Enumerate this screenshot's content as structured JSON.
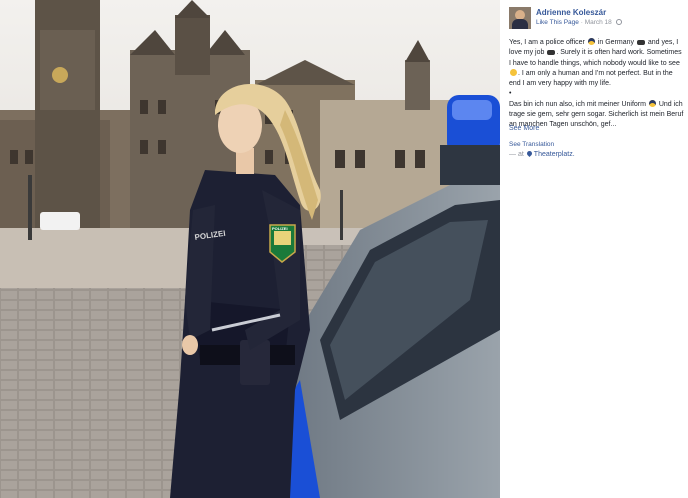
{
  "post": {
    "author": "Adrienne Koleszár",
    "like_page": "Like This Page",
    "separator": "·",
    "date": "March 18",
    "paragraph1_a": "Yes, I am a police officer",
    "paragraph1_b": "in Germany",
    "paragraph1_c": "and yes, I love my job",
    "paragraph1_d": ". Surely it is often hard work. Sometimes I have to handle things, which nobody would like to see",
    "paragraph1_e": ". I am only a human and I'm not perfect. But in the end I am very happy with my life.",
    "bullet": "•",
    "paragraph2_a": "Das bin ich nun also, ich mit meiner Uniform",
    "paragraph2_b": "Und ich trage sie gern, sehr gern sogar. Sicherlich ist mein Beruf an manchen Tagen unschön, gef...",
    "see_more": "See More",
    "see_translation": "See Translation",
    "location_prefix": "— at",
    "location": "Theaterplatz."
  },
  "photo": {
    "badge_text": "POLIZEI",
    "back_text": "POLIZEI",
    "colors": {
      "sky": "#e9e6e2",
      "uniform": "#1d2033",
      "hair": "#e6cf9c",
      "police_blue": "#1a4fd6"
    }
  }
}
